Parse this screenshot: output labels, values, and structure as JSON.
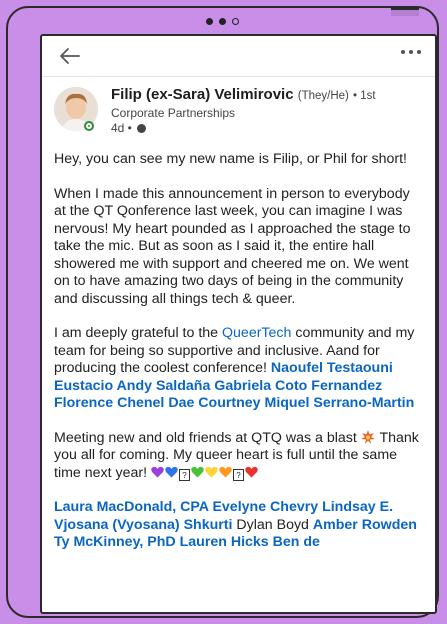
{
  "author": {
    "name": "Filip (ex-Sara) Velimirovic",
    "pronouns": "(They/He)",
    "degree": "• 1st",
    "headline": "Corporate Partnerships",
    "time": "4d •"
  },
  "post": {
    "p1": "Hey, you can see my new name is Filip, or Phil for short!",
    "p2": "When I made this announcement in person to everybody at the QT Qonference last week, you can imagine I was nervous! My heart pounded as I approached the stage to take the mic. But as soon as I said it, the entire hall showered me with support and cheered me on. We went on to have amazing two days of being in the community and discussing all things tech & queer.",
    "p3_a": "I am deeply grateful to the ",
    "p3_link": "QueerTech",
    "p3_b": " community and my team for being so supportive and inclusive. Aand for producing the coolest conference! ",
    "p3_mentions": "Naoufel Testaouni Eustacio Andy Saldaña Gabriela Coto Fernandez Florence Chenel Dae Courtney Miquel Serrano-Martin",
    "p4_a": "Meeting new and old friends at QTQ was a blast ",
    "p4_b": " Thank you all for coming. My queer heart is full until the same time next year! ",
    "p5_a": "Laura MacDonald, CPA Evelyne Chevry Lindsay E. Vjosana (Vyosana) Shkurti",
    "p5_b": " Dylan Boyd ",
    "p5_c": "Amber Rowden Ty McKinney, PhD Lauren Hicks Ben de",
    "box_glyph": "?"
  },
  "colors": {
    "background": "#c98fe8",
    "link": "#0a66c2",
    "online": "#2f8a3b"
  },
  "icons": {
    "back": "arrow-left-icon",
    "more": "more-horizontal-icon",
    "visibility": "globe-icon",
    "burst": "collision-emoji"
  }
}
